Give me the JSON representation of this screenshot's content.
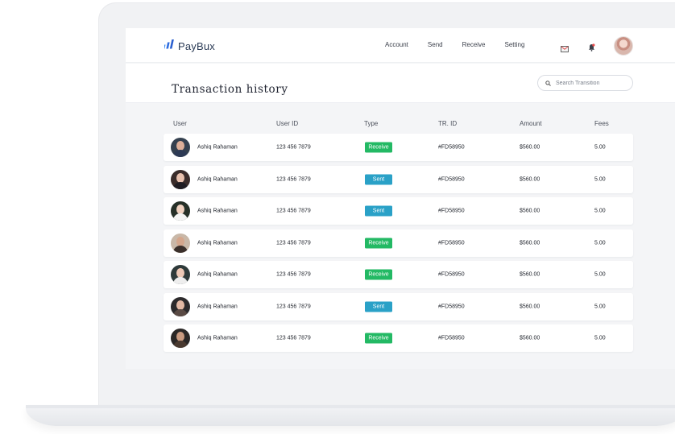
{
  "brand": {
    "name": "PayBux",
    "accent": "#2f6ee0"
  },
  "nav": {
    "items": [
      {
        "label": "Account"
      },
      {
        "label": "Send"
      },
      {
        "label": "Receive"
      },
      {
        "label": "Setting"
      }
    ]
  },
  "header_icons": [
    "mail-icon",
    "bell-icon",
    "user-avatar"
  ],
  "page": {
    "title": "Transaction history",
    "search_placeholder": "Search Transition"
  },
  "table": {
    "columns": [
      "User",
      "User ID",
      "Type",
      "TR. ID",
      "Amount",
      "Fees"
    ],
    "rows": [
      {
        "user": "Ashiq Rahaman",
        "user_id": "123 456 7879",
        "type": "Receive",
        "tr_id": "#FD58950",
        "amount": "$560.00",
        "fees": "5.00"
      },
      {
        "user": "Ashiq Rahaman",
        "user_id": "123 456 7879",
        "type": "Sent",
        "tr_id": "#FD58950",
        "amount": "$560.00",
        "fees": "5.00"
      },
      {
        "user": "Ashiq Rahaman",
        "user_id": "123 456 7879",
        "type": "Sent",
        "tr_id": "#FD58950",
        "amount": "$560.00",
        "fees": "5.00"
      },
      {
        "user": "Ashiq Rahaman",
        "user_id": "123 456 7879",
        "type": "Receive",
        "tr_id": "#FD58950",
        "amount": "$560.00",
        "fees": "5.00"
      },
      {
        "user": "Ashiq Rahaman",
        "user_id": "123 456 7879",
        "type": "Receive",
        "tr_id": "#FD58950",
        "amount": "$560.00",
        "fees": "5.00"
      },
      {
        "user": "Ashiq Rahaman",
        "user_id": "123 456 7879",
        "type": "Sent",
        "tr_id": "#FD58950",
        "amount": "$560.00",
        "fees": "5.00"
      },
      {
        "user": "Ashiq Rahaman",
        "user_id": "123 456 7879",
        "type": "Receive",
        "tr_id": "#FD58950",
        "amount": "$560.00",
        "fees": "5.00"
      }
    ]
  },
  "colors": {
    "receive": "#23b964",
    "sent": "#2aa1c7"
  }
}
